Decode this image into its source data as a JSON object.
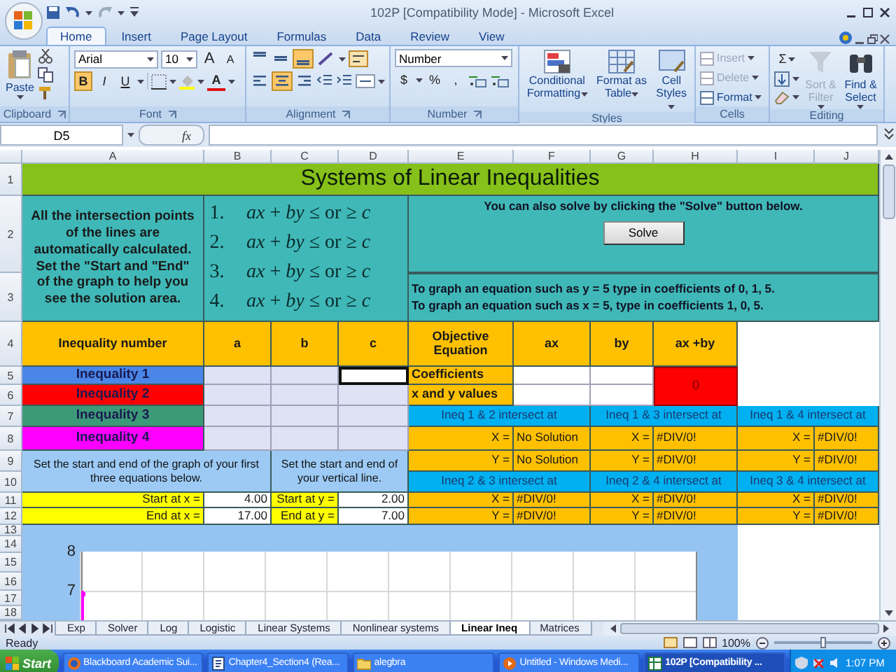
{
  "window": {
    "title": "102P  [Compatibility Mode] - Microsoft Excel"
  },
  "ribbon_tabs": [
    {
      "label": "Home",
      "selected": true
    },
    {
      "label": "Insert",
      "selected": false
    },
    {
      "label": "Page Layout",
      "selected": false
    },
    {
      "label": "Formulas",
      "selected": false
    },
    {
      "label": "Data",
      "selected": false
    },
    {
      "label": "Review",
      "selected": false
    },
    {
      "label": "View",
      "selected": false
    }
  ],
  "ribbon": {
    "clipboard": {
      "paste": "Paste",
      "group": "Clipboard"
    },
    "font": {
      "name": "Arial",
      "size": "10",
      "grow": "A",
      "shrink": "A",
      "bold": {
        "label": "B",
        "on": true
      },
      "italic": {
        "label": "I",
        "on": false
      },
      "underline": {
        "label": "U",
        "on": false
      },
      "color_letter": "A",
      "group": "Font"
    },
    "alignment": {
      "vertical": [
        {
          "on": false
        },
        {
          "on": false
        },
        {
          "on": true
        }
      ],
      "horizontal": [
        {
          "on": false
        },
        {
          "on": true
        },
        {
          "on": false
        }
      ],
      "group": "Alignment"
    },
    "number": {
      "format": "Number",
      "currency": "$",
      "percent": "%",
      "comma": ",",
      "group": "Number"
    },
    "styles": {
      "buttons": [
        "Conditional Formatting",
        "Format as Table",
        "Cell Styles"
      ],
      "group": "Styles"
    },
    "cells": {
      "buttons": [
        {
          "label": "Insert",
          "disabled": true
        },
        {
          "label": "Delete",
          "disabled": true
        },
        {
          "label": "Format",
          "disabled": false
        }
      ],
      "group": "Cells"
    },
    "editing": {
      "sum": "Σ",
      "buttons": [
        {
          "label": "Sort & Filter",
          "disabled": true
        },
        {
          "label": "Find & Select",
          "disabled": false
        }
      ],
      "group": "Editing"
    }
  },
  "formula_bar": {
    "name_box": "D5",
    "fx": "fx"
  },
  "sheet": {
    "columns": [
      "A",
      "B",
      "C",
      "D",
      "E",
      "F",
      "G",
      "H",
      "I",
      "J"
    ],
    "row_numbers": [
      "1",
      "2",
      "3",
      "4",
      "5",
      "6",
      "7",
      "8",
      "9",
      "10",
      "11",
      "12",
      "13",
      "14",
      "15",
      "16",
      "17",
      "18"
    ],
    "cells": [
      {
        "kind": "title",
        "text": "Systems of Linear Inequalities"
      },
      {
        "kind": "note",
        "text": "All the intersection points of the lines are automatically calculated. Set the \"Start and \"End\" of the graph to help you see the solution area."
      },
      {
        "kind": "formulas",
        "lines": [
          {
            "number": "1.",
            "expression": "*ax* + *by* ≤ or ≥ *c*"
          },
          {
            "number": "2.",
            "expression": "*ax* + *by* ≤ or ≥ *c*"
          },
          {
            "number": "3.",
            "expression": "*ax* + *by* ≤ or ≥ *c*"
          },
          {
            "number": "4.",
            "expression": "*ax* + *by* ≤ or ≥ *c*"
          }
        ]
      },
      {
        "kind": "solve",
        "text": "You can also solve by clicking the \"Solve\" button below.",
        "button": "Solve"
      },
      {
        "kind": "hint",
        "lines": [
          "To graph an equation such as y = 5 type in coefficients of 0, 1, 5.",
          "To graph an equation such as x = 5, type in coefficients 1, 0, 5."
        ]
      },
      {
        "kind": "head",
        "text": "Inequality number"
      },
      {
        "kind": "head",
        "text": "a"
      },
      {
        "kind": "head",
        "text": "b"
      },
      {
        "kind": "head",
        "text": "c"
      },
      {
        "kind": "head",
        "text": "Objective Equation"
      },
      {
        "kind": "head",
        "text": "ax"
      },
      {
        "kind": "head",
        "text": "by"
      },
      {
        "kind": "head",
        "text": "ax +by"
      },
      {
        "kind": "ineq",
        "text": "Inequality 1",
        "color": "#4a86e8"
      },
      {
        "kind": "input",
        "selected": false
      },
      {
        "kind": "input",
        "selected": false
      },
      {
        "kind": "input",
        "selected": true
      },
      {
        "kind": "label",
        "text": "Coefficients"
      },
      {
        "kind": "result",
        "text": "0"
      },
      {
        "kind": "ineq",
        "text": "Inequality 2",
        "color": "#ff0000"
      },
      {
        "kind": "input",
        "selected": false
      },
      {
        "kind": "input",
        "selected": false
      },
      {
        "kind": "input",
        "selected": false
      },
      {
        "kind": "label",
        "text": "x and y values"
      },
      {
        "kind": "ineq",
        "text": "Inequality 3",
        "color": "#3d9a78"
      },
      {
        "kind": "input",
        "selected": false
      },
      {
        "kind": "input",
        "selected": false
      },
      {
        "kind": "input",
        "selected": false
      },
      {
        "kind": "inter",
        "text": "Ineq 1 & 2 intersect at"
      },
      {
        "kind": "inter",
        "text": "Ineq 1 & 3 intersect at"
      },
      {
        "kind": "inter",
        "text": "Ineq 1 & 4 intersect at"
      },
      {
        "kind": "ineq",
        "text": "Inequality 4",
        "color": "#ff00ff"
      },
      {
        "kind": "input",
        "selected": false
      },
      {
        "kind": "input",
        "selected": false
      },
      {
        "kind": "input",
        "selected": false
      },
      {
        "kind": "eq",
        "text": "X ="
      },
      {
        "kind": "value",
        "text": "No Solution"
      },
      {
        "kind": "eq",
        "text": "X ="
      },
      {
        "kind": "value",
        "text": "#DIV/0!"
      },
      {
        "kind": "eq",
        "text": "X ="
      },
      {
        "kind": "value",
        "text": "#DIV/0!"
      },
      {
        "kind": "range_note",
        "text": "Set the start and end of the graph of your first three equations below."
      },
      {
        "kind": "range_note",
        "text": "Set the start and end of your vertical line."
      },
      {
        "kind": "eq",
        "text": "Y ="
      },
      {
        "kind": "value",
        "text": "No Solution"
      },
      {
        "kind": "eq",
        "text": "Y ="
      },
      {
        "kind": "value",
        "text": "#DIV/0!"
      },
      {
        "kind": "eq",
        "text": "Y ="
      },
      {
        "kind": "value",
        "text": "#DIV/0!"
      },
      {
        "kind": "inter",
        "text": "Ineq 2 & 3 intersect at"
      },
      {
        "kind": "inter",
        "text": "Ineq 2 & 4 intersect at"
      },
      {
        "kind": "inter",
        "text": "Ineq 3 & 4 intersect at"
      },
      {
        "kind": "range_label",
        "text": "Start at x ="
      },
      {
        "kind": "range_value",
        "text": "4.00"
      },
      {
        "kind": "range_label",
        "text": "Start at y ="
      },
      {
        "kind": "range_value",
        "text": "2.00"
      },
      {
        "kind": "eq",
        "text": "X ="
      },
      {
        "kind": "value",
        "text": "#DIV/0!"
      },
      {
        "kind": "eq",
        "text": "X ="
      },
      {
        "kind": "value",
        "text": "#DIV/0!"
      },
      {
        "kind": "eq",
        "text": "X ="
      },
      {
        "kind": "value",
        "text": "#DIV/0!"
      },
      {
        "kind": "range_label",
        "text": "End at x ="
      },
      {
        "kind": "range_value",
        "text": "17.00"
      },
      {
        "kind": "range_label",
        "text": "End at y ="
      },
      {
        "kind": "range_value",
        "text": "7.00"
      },
      {
        "kind": "eq",
        "text": "Y ="
      },
      {
        "kind": "value",
        "text": "#DIV/0!"
      },
      {
        "kind": "eq",
        "text": "Y ="
      },
      {
        "kind": "value",
        "text": "#DIV/0!"
      },
      {
        "kind": "eq",
        "text": "Y ="
      },
      {
        "kind": "value",
        "text": "#DIV/0!"
      }
    ],
    "chart": {
      "y_labels": [
        "8",
        "7"
      ]
    }
  },
  "sheet_tabs": [
    {
      "label": "Exp",
      "selected": false
    },
    {
      "label": "Solver",
      "selected": false
    },
    {
      "label": "Log",
      "selected": false
    },
    {
      "label": "Logistic",
      "selected": false
    },
    {
      "label": "Linear Systems",
      "selected": false
    },
    {
      "label": "Nonlinear systems",
      "selected": false
    },
    {
      "label": "Linear Ineq",
      "selected": true
    },
    {
      "label": "Matrices",
      "selected": false
    }
  ],
  "status": {
    "text": "Ready",
    "zoom": "100%",
    "zoom_slider": {
      "level": 0.5
    }
  },
  "taskbar": {
    "start": "Start",
    "items": [
      {
        "kind": "browser",
        "label": "Blackboard Academic Sui...",
        "selected": false
      },
      {
        "kind": "document",
        "label": "Chapter4_Section4 (Rea...",
        "selected": false
      },
      {
        "kind": "folder",
        "label": "alegbra",
        "selected": false
      },
      {
        "kind": "media",
        "label": "Untitled - Windows Medi...",
        "selected": false
      },
      {
        "kind": "spreadsheet",
        "label": "102P  [Compatibility ...",
        "selected": true
      }
    ],
    "clock": "1:07 PM"
  }
}
